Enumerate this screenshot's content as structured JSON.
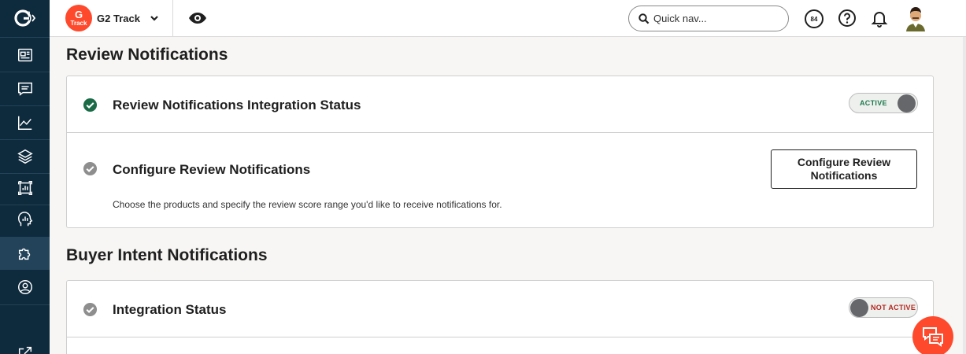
{
  "app": {
    "brand_badge_letter": "G",
    "brand_badge_sub": "Track",
    "product_name": "G2 Track"
  },
  "header": {
    "search_placeholder": "Quick nav...",
    "score_value": "84"
  },
  "sidebar": {
    "items": [
      {
        "icon": "newspaper-icon"
      },
      {
        "icon": "message-icon"
      },
      {
        "icon": "line-chart-icon"
      },
      {
        "icon": "layers-icon"
      },
      {
        "icon": "report-frame-icon"
      },
      {
        "icon": "head-chart-icon"
      },
      {
        "icon": "puzzle-icon",
        "active": true
      },
      {
        "icon": "user-circle-icon"
      },
      {
        "icon": "external-link-icon"
      }
    ]
  },
  "review_section": {
    "title": "Review Notifications",
    "integration_status_title": "Review Notifications Integration Status",
    "integration_status_toggle": "ACTIVE",
    "configure_title": "Configure Review Notifications",
    "configure_desc": "Choose the products and specify the review score range you'd like to receive notifications for.",
    "configure_button": "Configure Review Notifications"
  },
  "buyer_section": {
    "title": "Buyer Intent Notifications",
    "integration_status_title": "Integration Status",
    "integration_status_toggle": "NOT ACTIVE"
  },
  "colors": {
    "sidebar_bg": "#0e2a3d",
    "brand_red": "#ff492c",
    "active_green": "#1f7a4d",
    "inactive_red": "#b3261e",
    "check_green": "#1b6b47",
    "check_grey": "#8e8e8e"
  }
}
